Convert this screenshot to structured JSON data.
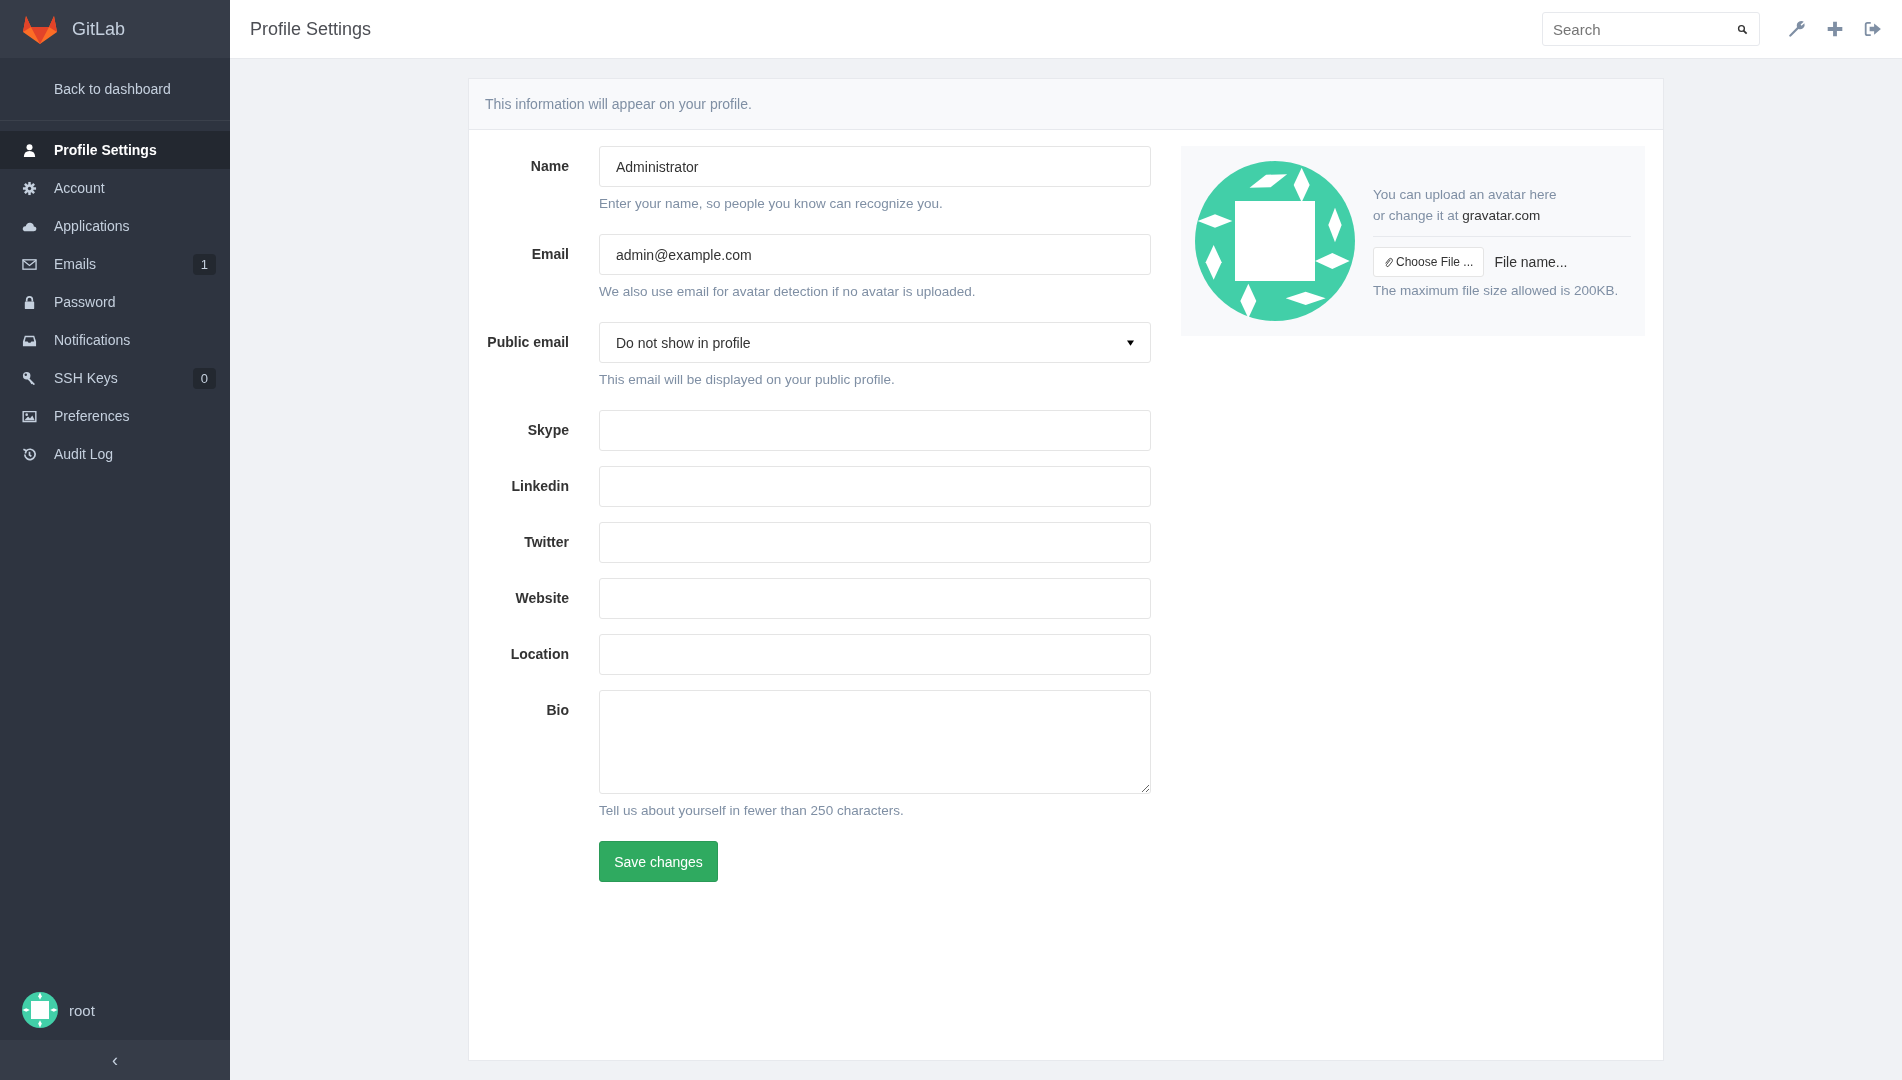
{
  "brand": {
    "name": "GitLab"
  },
  "sidebar": {
    "back_link": "Back to dashboard",
    "items": [
      {
        "label": "Profile Settings",
        "selected": true
      },
      {
        "label": "Account",
        "selected": false
      },
      {
        "label": "Applications",
        "selected": false
      },
      {
        "label": "Emails",
        "selected": false,
        "count": "1"
      },
      {
        "label": "Password",
        "selected": false
      },
      {
        "label": "Notifications",
        "selected": false
      },
      {
        "label": "SSH Keys",
        "selected": false,
        "count": "0"
      },
      {
        "label": "Preferences",
        "selected": false
      },
      {
        "label": "Audit Log",
        "selected": false
      }
    ],
    "user": {
      "name": "root"
    },
    "collapse": "‹"
  },
  "header": {
    "title": "Profile Settings",
    "search": {
      "placeholder": "Search"
    }
  },
  "panel": {
    "intro": "This information will appear on your profile.",
    "fields": [
      {
        "kind": "text",
        "label": "Name",
        "value": "Administrator",
        "help": "Enter your name, so people you know can recognize you."
      },
      {
        "kind": "text",
        "label": "Email",
        "value": "admin@example.com",
        "help": "We also use email for avatar detection if no avatar is uploaded."
      },
      {
        "kind": "select",
        "label": "Public email",
        "value": "Do not show in profile",
        "help": "This email will be displayed on your public profile."
      },
      {
        "kind": "text",
        "label": "Skype"
      },
      {
        "kind": "text",
        "label": "Linkedin"
      },
      {
        "kind": "text",
        "label": "Twitter"
      },
      {
        "kind": "text",
        "label": "Website"
      },
      {
        "kind": "text",
        "label": "Location"
      },
      {
        "kind": "textarea",
        "label": "Bio",
        "help": "Tell us about yourself in fewer than 250 characters."
      }
    ],
    "save_button": "Save changes",
    "avatar": {
      "text": "You can upload an avatar here",
      "text2": "or change it at",
      "link": "gravatar.com",
      "choose_button": "Choose File ...",
      "file_name": "File name...",
      "note": "The maximum file size allowed is 200KB."
    }
  }
}
